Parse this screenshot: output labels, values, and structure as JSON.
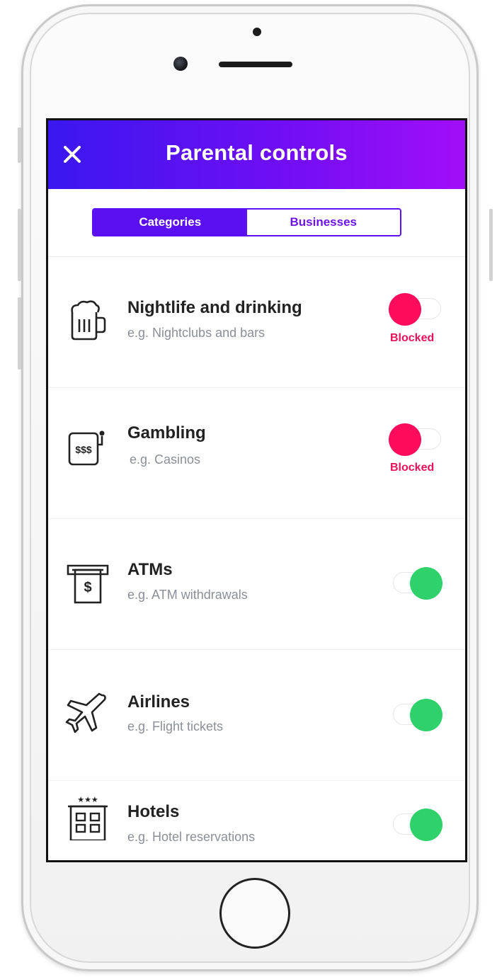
{
  "header": {
    "title": "Parental controls",
    "close_icon": "close-icon"
  },
  "tabs": {
    "categories_label": "Categories",
    "businesses_label": "Businesses",
    "selected": "Categories"
  },
  "colors": {
    "header_gradient_start": "#3a17f0",
    "header_gradient_end": "#a10ef7",
    "accent": "#5a10f2",
    "blocked": "#ff0b5c",
    "allowed": "#2ed16a"
  },
  "categories": [
    {
      "icon": "beer-mug-icon",
      "title": "Nightlife and drinking",
      "subtitle": "e.g. Nightclubs and bars",
      "status": "Blocked",
      "enabled": false
    },
    {
      "icon": "slot-machine-icon",
      "title": "Gambling",
      "subtitle": "e.g. Casinos",
      "status": "Blocked",
      "enabled": false
    },
    {
      "icon": "atm-icon",
      "title": "ATMs",
      "subtitle": "e.g. ATM withdrawals",
      "enabled": true
    },
    {
      "icon": "airplane-icon",
      "title": "Airlines",
      "subtitle": "e.g. Flight tickets",
      "enabled": true
    },
    {
      "icon": "hotel-icon",
      "title": "Hotels",
      "subtitle": "e.g. Hotel reservations",
      "enabled": true
    }
  ]
}
